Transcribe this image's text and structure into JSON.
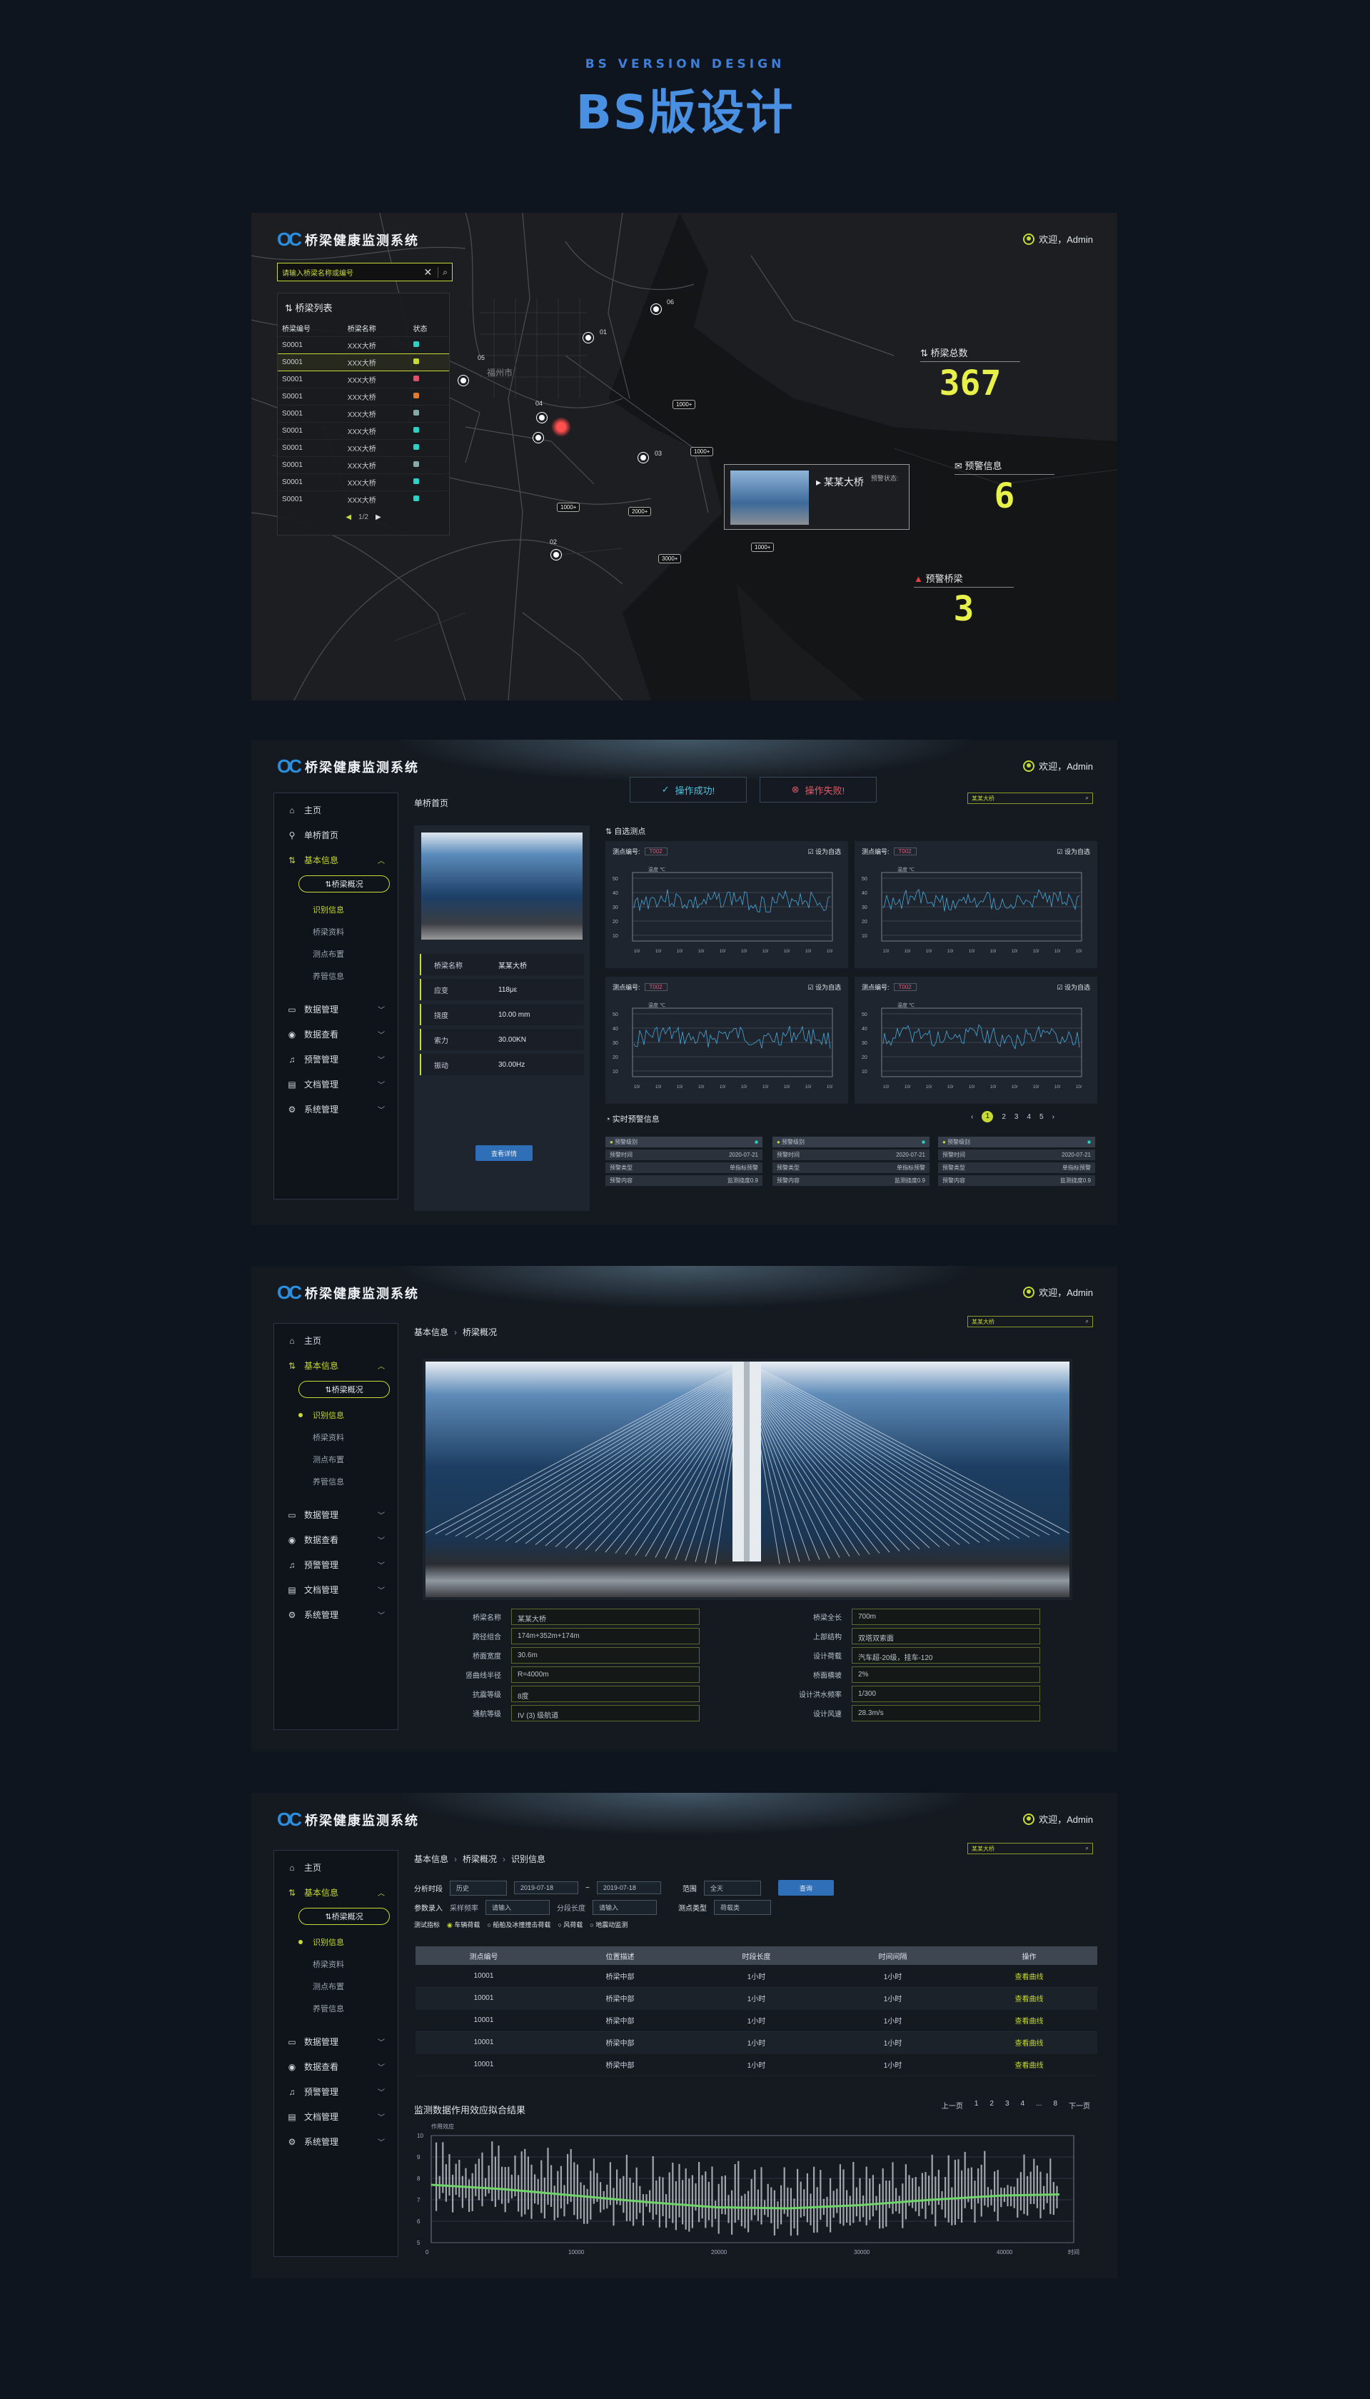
{
  "header": {
    "en": "BS VERSION DESIGN",
    "cn": "BS版设计"
  },
  "app": {
    "title": "桥梁健康监测系统",
    "user": "欢迎，Admin",
    "search_placeholder": "请输入桥梁名称或编号"
  },
  "map": {
    "list_title": "桥梁列表",
    "cols": [
      "桥梁编号",
      "桥梁名称",
      "状态"
    ],
    "rows": [
      [
        "S0001",
        "XXX大桥",
        "#2fd1c6"
      ],
      [
        "S0001",
        "XXX大桥",
        "#c6d934"
      ],
      [
        "S0001",
        "XXX大桥",
        "#e0506a"
      ],
      [
        "S0001",
        "XXX大桥",
        "#e07a30"
      ],
      [
        "S0001",
        "XXX大桥",
        "#8aa"
      ],
      [
        "S0001",
        "XXX大桥",
        "#2fd1c6"
      ],
      [
        "S0001",
        "XXX大桥",
        "#2fd1c6"
      ],
      [
        "S0001",
        "XXX大桥",
        "#8aa"
      ],
      [
        "S0001",
        "XXX大桥",
        "#2fd1c6"
      ],
      [
        "S0001",
        "XXX大桥",
        "#2fd1c6"
      ]
    ],
    "page": "1/2",
    "stats": [
      {
        "label": "桥梁总数",
        "value": "367"
      },
      {
        "label": "预警信息",
        "value": "6"
      },
      {
        "label": "预警桥梁",
        "value": "3"
      }
    ],
    "pins": [
      "01",
      "02",
      "03",
      "04",
      "05",
      "06"
    ],
    "city": "福州市",
    "tags": [
      "1000+",
      "1000+",
      "1000+",
      "2000+",
      "3000+",
      "1000+"
    ],
    "popup": {
      "name": "某某大桥",
      "status": "预警状态:"
    }
  },
  "nav": {
    "items": [
      "主页",
      "单桥首页",
      "基本信息",
      "数据管理",
      "数据查看",
      "预警管理",
      "文档管理",
      "系统管理"
    ],
    "sub_pill": "桥梁概况",
    "subs": [
      "识别信息",
      "桥梁资料",
      "测点布置",
      "养管信息"
    ]
  },
  "s2": {
    "crumb": "单桥首页",
    "ok": "操作成功!",
    "fail": "操作失败!",
    "search": "某某大桥",
    "info": [
      [
        "桥梁名称",
        "某某大桥"
      ],
      [
        "应变",
        "118με"
      ],
      [
        "挠度",
        "10.00 mm"
      ],
      [
        "索力",
        "30.00KN"
      ],
      [
        "振动",
        "30.00Hz"
      ]
    ],
    "btn": "查看详情",
    "sel_title": "自选测点",
    "mp_label": "测点编号:",
    "mp": "T002",
    "set": "设为自选",
    "unit": "温度 ℃",
    "yt": [
      "50",
      "40",
      "30",
      "20",
      "10"
    ],
    "alarm_title": "实时预警信息",
    "pages": [
      "1",
      "2",
      "3",
      "4",
      "5"
    ],
    "alarm": [
      [
        "预警级别",
        ""
      ],
      [
        "预警时间",
        "2020-07-21"
      ],
      [
        "预警类型",
        "单指标预警"
      ],
      [
        "预警内容",
        "监测挠度0.9"
      ]
    ]
  },
  "s3": {
    "crumb": [
      "基本信息",
      "桥梁概况"
    ],
    "search": "某某大桥",
    "left": [
      [
        "桥梁名称",
        "某某大桥"
      ],
      [
        "跨径组合",
        "174m+352m+174m"
      ],
      [
        "桥面宽度",
        "30.6m"
      ],
      [
        "竖曲线半径",
        "R=4000m"
      ],
      [
        "抗震等级",
        "8度"
      ],
      [
        "通航等级",
        "IV (3) 级航道"
      ]
    ],
    "right": [
      [
        "桥梁全长",
        "700m"
      ],
      [
        "上部结构",
        "双塔双索面"
      ],
      [
        "设计荷载",
        "汽车超-20级，挂车-120"
      ],
      [
        "桥面横坡",
        "2%"
      ],
      [
        "设计洪水频率",
        "1/300"
      ],
      [
        "设计风速",
        "28.3m/s"
      ]
    ]
  },
  "s4": {
    "crumb": [
      "基本信息",
      "桥梁概况",
      "识别信息"
    ],
    "search": "某某大桥",
    "period_label": "分析时段",
    "period": "历史",
    "d1": "2019-07-18",
    "d2": "2019-07-18",
    "range_label": "范围",
    "range": "全天",
    "query": "查询",
    "param_label": "参数录入",
    "p1": "采样频率",
    "p1v": "请输入",
    "p2": "分段长度",
    "p2v": "请输入",
    "type_label": "测点类型",
    "type": "荷载类",
    "radio_label": "测试指标",
    "radios": [
      "车辆荷载",
      "船舶及冰撞撞击荷载",
      "风荷载",
      "地震动监测"
    ],
    "cols": [
      "测点编号",
      "位置描述",
      "时段长度",
      "时间间隔",
      "操作"
    ],
    "rows": [
      [
        "10001",
        "桥梁中部",
        "1小时",
        "1小时",
        "查看曲线"
      ],
      [
        "10001",
        "桥梁中部",
        "1小时",
        "1小时",
        "查看曲线"
      ],
      [
        "10001",
        "桥梁中部",
        "1小时",
        "1小时",
        "查看曲线"
      ],
      [
        "10001",
        "桥梁中部",
        "1小时",
        "1小时",
        "查看曲线"
      ],
      [
        "10001",
        "桥梁中部",
        "1小时",
        "1小时",
        "查看曲线"
      ]
    ],
    "chart_title": "监测数据作用效应拟合结果",
    "prev": "上一页",
    "next": "下一页",
    "pages": [
      "1",
      "2",
      "3",
      "4",
      "...",
      "8"
    ]
  },
  "chart_data": {
    "type": "bar",
    "title": "监测数据作用效应拟合结果",
    "ylabel": "作用效应",
    "xlabel": "时间",
    "ylim": [
      5,
      10
    ],
    "xlim": [
      0,
      45000
    ],
    "xticks": [
      "0",
      "10000",
      "20000",
      "30000",
      "40000"
    ],
    "yticks": [
      "10",
      "9",
      "8",
      "7",
      "6",
      "5"
    ],
    "fit_line": [
      [
        0,
        7.7
      ],
      [
        5000,
        7.5
      ],
      [
        10000,
        7.2
      ],
      [
        15000,
        6.9
      ],
      [
        20000,
        6.65
      ],
      [
        25000,
        6.6
      ],
      [
        30000,
        6.75
      ],
      [
        35000,
        7.0
      ],
      [
        40000,
        7.2
      ],
      [
        44000,
        7.25
      ]
    ]
  }
}
